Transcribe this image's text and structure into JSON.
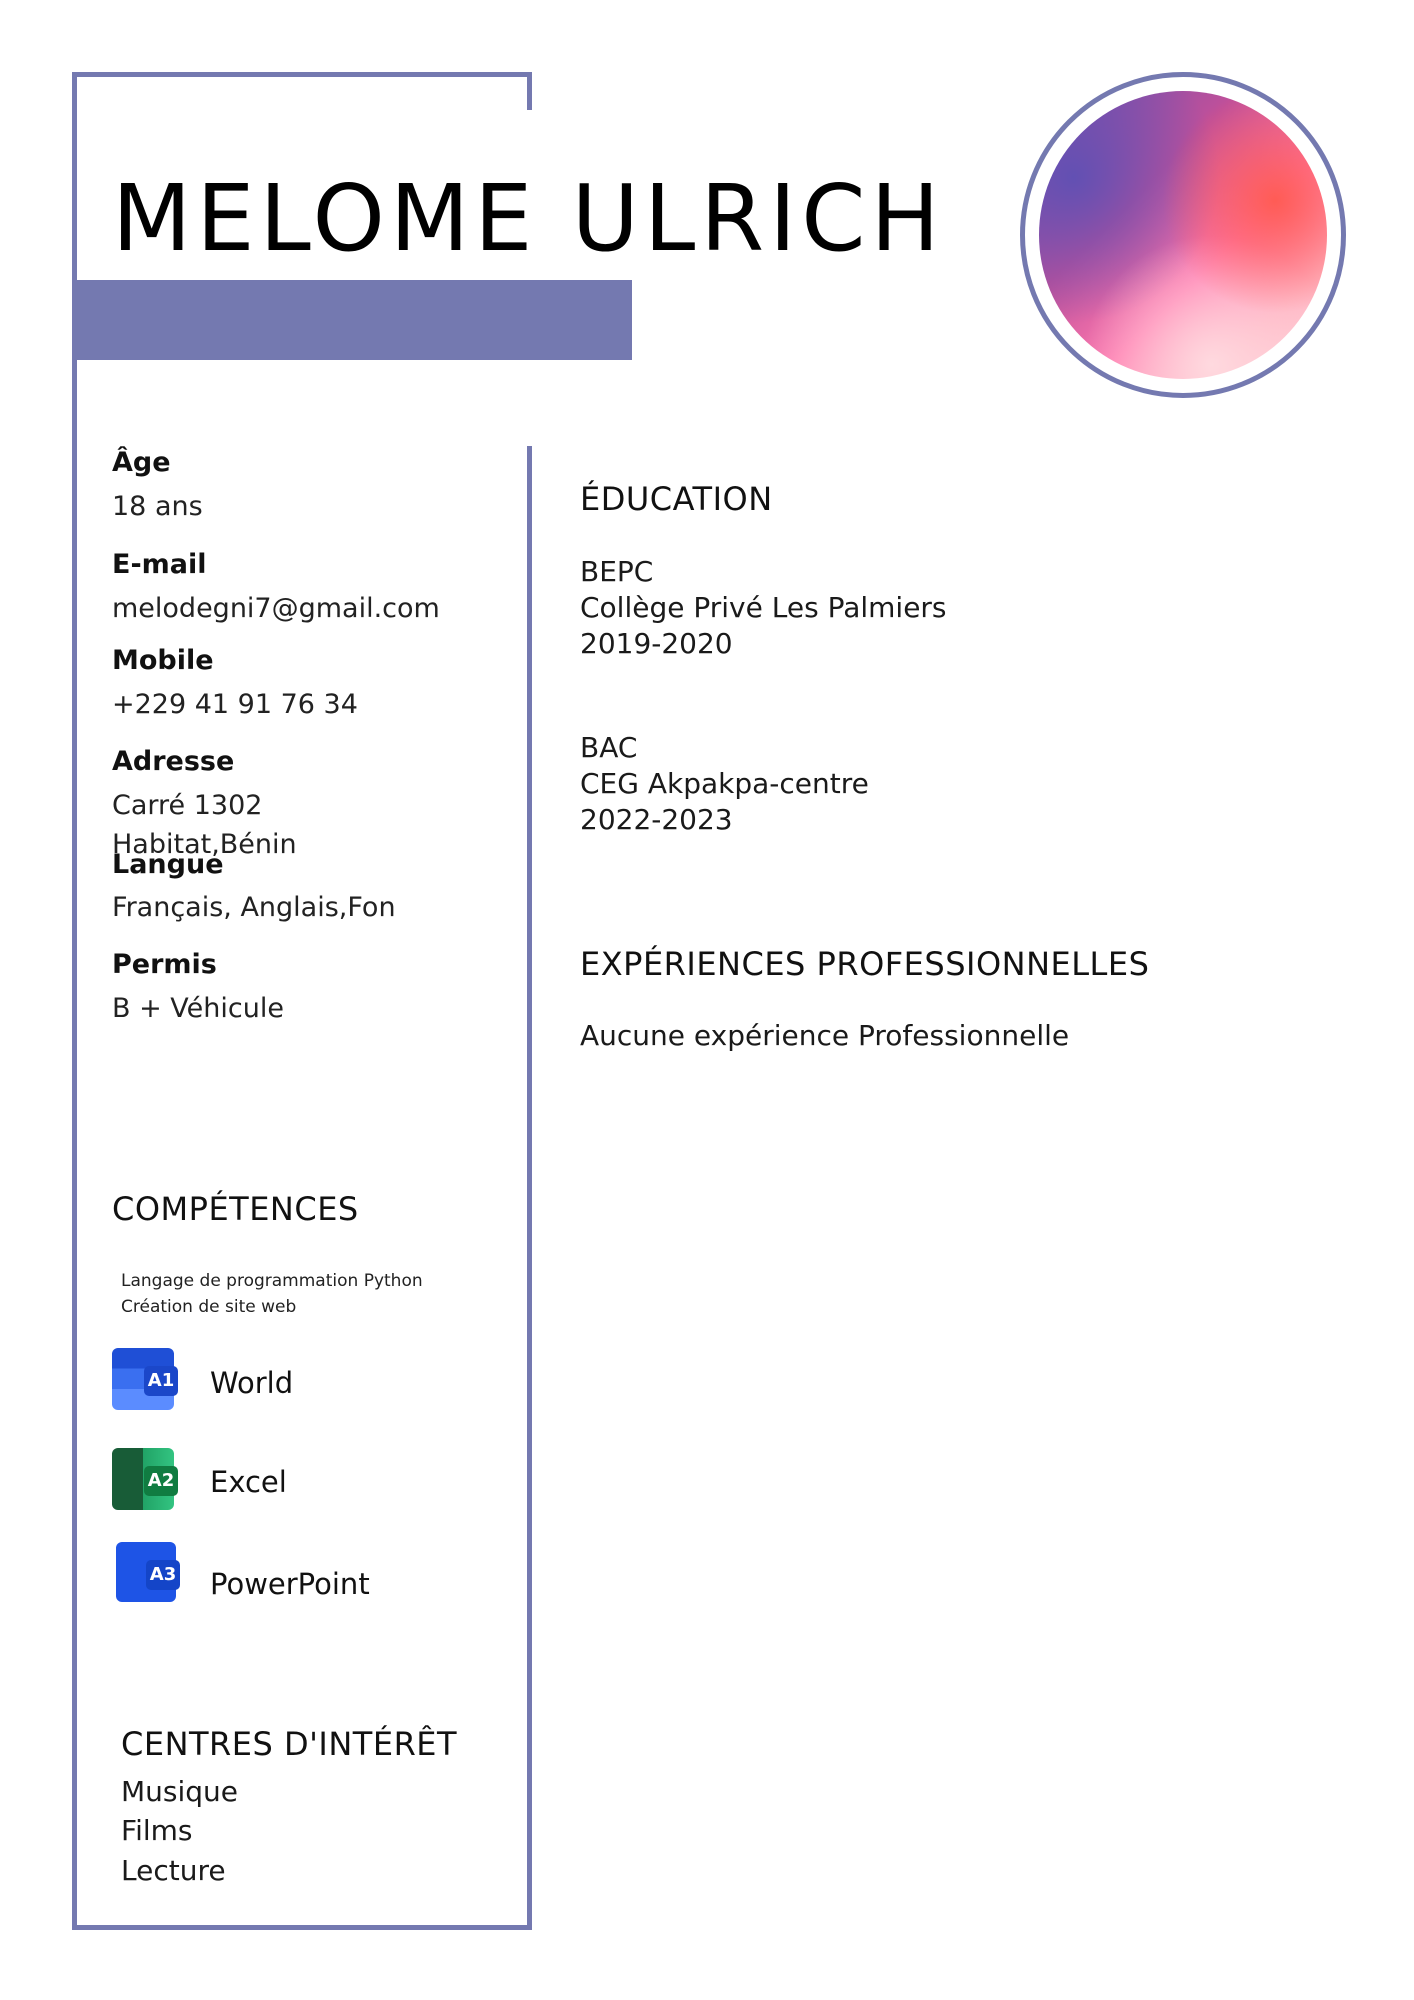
{
  "name": "MELOME ULRICH",
  "colors": {
    "accent": "#7479b0"
  },
  "photo": {
    "icon": "profile-photo"
  },
  "info": [
    {
      "label": "Âge",
      "value": "18 ans"
    },
    {
      "label": "E-mail",
      "value": "melodegni7@gmail.com"
    },
    {
      "label": "Mobile",
      "value": "+229 41 91 76 34"
    },
    {
      "label": "Adresse",
      "value": "Carré 1302",
      "value2": "Habitat,Bénin"
    },
    {
      "label": "Langue",
      "value": "Français, Anglais,Fon"
    },
    {
      "label": "Permis",
      "value": "B + Véhicule"
    }
  ],
  "competences": {
    "title": "COMPÉTENCES",
    "lines": [
      "Langage de programmation Python",
      "Création de site web"
    ],
    "apps": [
      {
        "badge": "A1",
        "name": "World",
        "icon": "word-icon",
        "color": "#2e5fe8"
      },
      {
        "badge": "A2",
        "name": "Excel",
        "icon": "excel-icon",
        "color": "#1e7a45"
      },
      {
        "badge": "A3",
        "name": "PowerPoint",
        "icon": "powerpoint-icon",
        "color": "#1e54e6"
      }
    ]
  },
  "interets": {
    "title": "CENTRES D'INTÉRÊT",
    "items": [
      "Musique",
      "Films",
      "Lecture"
    ]
  },
  "education": {
    "title": "ÉDUCATION",
    "entries": [
      {
        "degree": "BEPC",
        "school": "Collège Privé Les Palmiers",
        "years": "2019-2020"
      },
      {
        "degree": "BAC",
        "school": "CEG Akpakpa-centre",
        "years": "2022-2023"
      }
    ]
  },
  "experience": {
    "title": "EXPÉRIENCES PROFESSIONNELLES",
    "text": "Aucune expérience Professionnelle"
  }
}
